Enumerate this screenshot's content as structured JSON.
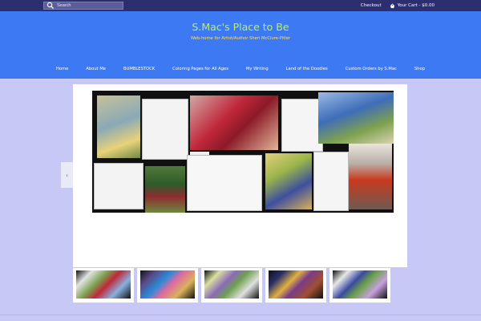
{
  "topbar": {
    "search_placeholder": "Search",
    "checkout_label": "Checkout",
    "cart_label": "Your Cart - $0.00"
  },
  "header": {
    "title": "S.Mac's Place to Be",
    "tagline": "Web-home for Artist/Author Sheri McClure-Pitler"
  },
  "nav": {
    "items": [
      "Home",
      "About Me",
      "BUMBLESTOCK",
      "Coloring Pages for All Ages",
      "My Writing",
      "Land of the Doodles",
      "Custom Orders by S.Mac",
      "Shop"
    ]
  },
  "slider": {
    "prev_icon": "chevron-left-icon",
    "prev_glyph": "‹"
  },
  "colors": {
    "topbar": "#2b2e6f",
    "header": "#3d79f2",
    "title": "#b8f06a",
    "tagline": "#ffe15a",
    "background": "#c7c8f5"
  }
}
